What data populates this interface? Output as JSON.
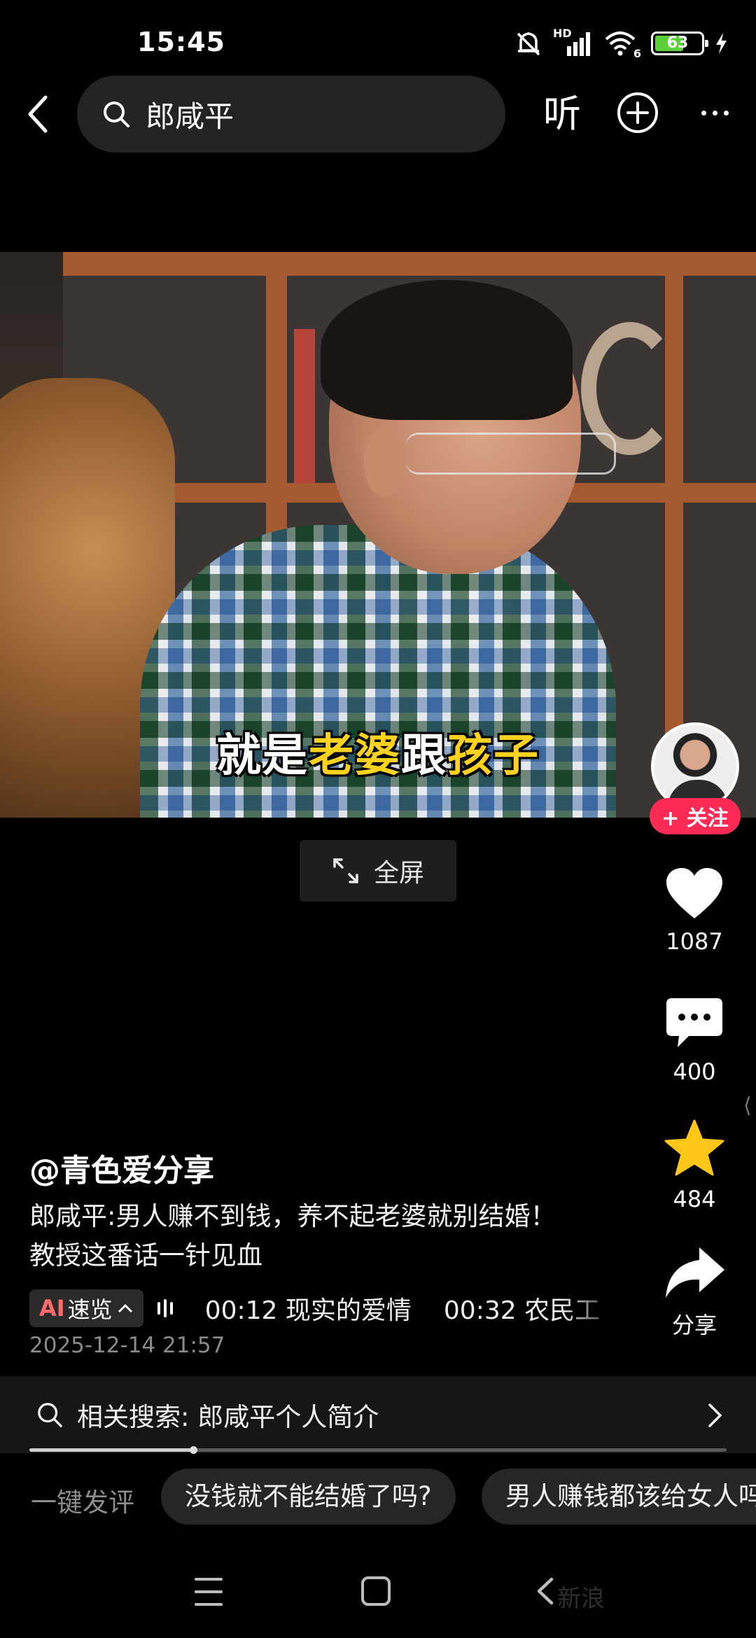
{
  "status_bar": {
    "time": "15:45",
    "network_label": "HD",
    "wifi_sub": "6",
    "battery_level": "63",
    "battery_fraction": 0.63,
    "icons": [
      "mute-icon",
      "signal-icon",
      "wifi-icon",
      "battery-icon",
      "charging-icon"
    ]
  },
  "header": {
    "search_query": "郎咸平",
    "listen_label": "听",
    "icons": [
      "back-arrow-icon",
      "search-icon",
      "add-circle-icon",
      "more-icon"
    ]
  },
  "video": {
    "subtitle_part1": "就是",
    "subtitle_part2": "老婆",
    "subtitle_part3": "跟",
    "subtitle_part4": "孩子",
    "highlight_color": "#ffd21f"
  },
  "fullscreen": {
    "label": "全屏"
  },
  "actions": {
    "follow_label": "+ 关注",
    "likes": "1087",
    "comments": "400",
    "favorites": "484",
    "share_label": "分享",
    "follow_color": "#fe2c55",
    "favorite_color": "#ffc61a"
  },
  "post": {
    "author": "@青色爱分享",
    "caption_line1": "郎咸平:男人赚不到钱，养不起老婆就别结婚！",
    "caption_line2": "教授这番话一针见血",
    "ai_prefix": "AI",
    "ai_label": "速览",
    "chapters": [
      {
        "time": "00:12",
        "title": "现实的爱情"
      },
      {
        "time": "00:32",
        "title": "农民工"
      }
    ],
    "timestamp": "2025-12-14 21:57"
  },
  "related_search": {
    "label": "相关搜索: 郎咸平个人简介",
    "progress_fraction": 0.235
  },
  "quick_comment": {
    "label": "一键发评",
    "chips": [
      "没钱就不能结婚了吗?",
      "男人赚钱都该给女人吗"
    ]
  },
  "bottom_nav": {
    "watermark": "新浪"
  }
}
